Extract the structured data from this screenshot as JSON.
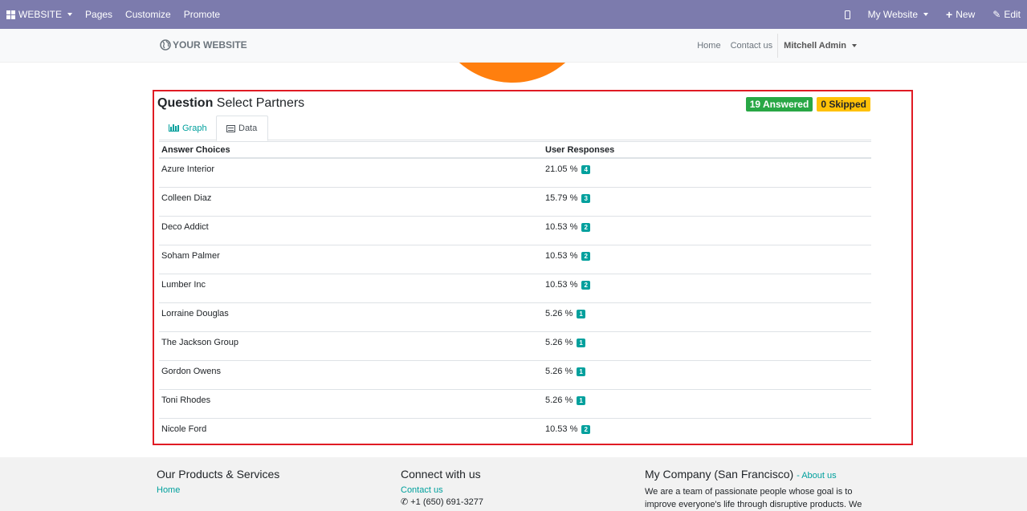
{
  "topbar": {
    "website_label": "WEBSITE",
    "pages_label": "Pages",
    "customize_label": "Customize",
    "promote_label": "Promote",
    "mywebsite_label": "My Website",
    "new_label": "New",
    "edit_label": "Edit"
  },
  "header": {
    "logo_text": "YOUR WEBSITE",
    "nav_home": "Home",
    "nav_contact": "Contact us",
    "user_name": "Mitchell Admin"
  },
  "question": {
    "title_prefix": "Question",
    "title_text": "Select Partners",
    "answered_badge": "19 Answered",
    "skipped_badge": "0 Skipped",
    "tab_graph": "Graph",
    "tab_data": "Data",
    "col_choices": "Answer Choices",
    "col_responses": "User Responses",
    "rows": [
      {
        "choice": "Azure Interior",
        "percent": "21.05 %",
        "count": "4"
      },
      {
        "choice": "Colleen Diaz",
        "percent": "15.79 %",
        "count": "3"
      },
      {
        "choice": "Deco Addict",
        "percent": "10.53 %",
        "count": "2"
      },
      {
        "choice": "Soham Palmer",
        "percent": "10.53 %",
        "count": "2"
      },
      {
        "choice": "Lumber Inc",
        "percent": "10.53 %",
        "count": "2"
      },
      {
        "choice": "Lorraine Douglas",
        "percent": "5.26 %",
        "count": "1"
      },
      {
        "choice": "The Jackson Group",
        "percent": "5.26 %",
        "count": "1"
      },
      {
        "choice": "Gordon Owens",
        "percent": "5.26 %",
        "count": "1"
      },
      {
        "choice": "Toni Rhodes",
        "percent": "5.26 %",
        "count": "1"
      },
      {
        "choice": "Nicole Ford",
        "percent": "10.53 %",
        "count": "2"
      }
    ]
  },
  "footer": {
    "products_title": "Our Products & Services",
    "products_home": "Home",
    "connect_title": "Connect with us",
    "connect_contact": "Contact us",
    "connect_phone": "+1 (650) 691-3277",
    "company_title": "My Company (San Francisco)",
    "company_about": "About us",
    "company_text": "We are a team of passionate people whose goal is to improve everyone's life through disruptive products. We"
  },
  "colors": {
    "topbar": "#7c7bad",
    "accent": "#00a09d",
    "answered": "#28a745",
    "skipped": "#ffc107",
    "highlight_border": "#e01b24",
    "chart_orange": "#ff7f0e"
  }
}
